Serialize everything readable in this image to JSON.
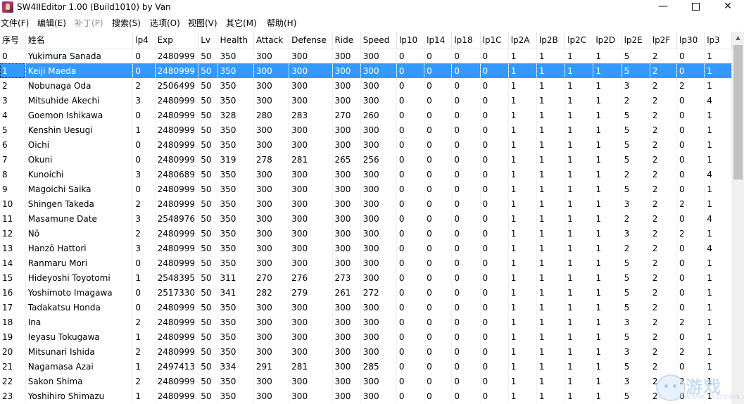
{
  "window": {
    "title": "SW4IIEditor 1.00 (Build1010) by Van",
    "minimize_glyph": "—",
    "close_glyph": "✕"
  },
  "menu": [
    {
      "label": "文件(F)",
      "enabled": true
    },
    {
      "label": "编辑(E)",
      "enabled": true
    },
    {
      "label": "补丁(P)",
      "enabled": false
    },
    {
      "label": "搜索(S)",
      "enabled": true
    },
    {
      "label": "选项(O)",
      "enabled": true
    },
    {
      "label": "视图(V)",
      "enabled": true
    },
    {
      "label": "其它(M)",
      "enabled": true
    },
    {
      "label": "帮助(H)",
      "enabled": true
    }
  ],
  "grid": {
    "columns": [
      "序号",
      "姓名",
      "lp4",
      "Exp",
      "Lv",
      "Health",
      "Attack",
      "Defense",
      "Ride",
      "Speed",
      "lp10",
      "lp14",
      "lp18",
      "lp1C",
      "lp2A",
      "lp2B",
      "lp2C",
      "lp2D",
      "lp2E",
      "lp2F",
      "lp30",
      "lp3"
    ],
    "selected_index": 1,
    "rows": [
      [
        "0",
        "Yukimura Sanada",
        "0",
        "2480999",
        "50",
        "350",
        "300",
        "300",
        "300",
        "300",
        "0",
        "0",
        "0",
        "0",
        "1",
        "1",
        "1",
        "1",
        "5",
        "2",
        "0",
        "1"
      ],
      [
        "1",
        "Keiji Maeda",
        "0",
        "2480999",
        "50",
        "350",
        "300",
        "300",
        "300",
        "300",
        "0",
        "0",
        "0",
        "0",
        "1",
        "1",
        "1",
        "1",
        "5",
        "2",
        "0",
        "1"
      ],
      [
        "2",
        "Nobunaga Oda",
        "2",
        "2506499",
        "50",
        "350",
        "300",
        "300",
        "300",
        "300",
        "0",
        "0",
        "0",
        "0",
        "1",
        "1",
        "1",
        "1",
        "3",
        "2",
        "2",
        "1"
      ],
      [
        "3",
        "Mitsuhide Akechi",
        "3",
        "2480999",
        "50",
        "350",
        "300",
        "300",
        "300",
        "300",
        "0",
        "0",
        "0",
        "0",
        "1",
        "1",
        "1",
        "1",
        "2",
        "2",
        "0",
        "4"
      ],
      [
        "4",
        "Goemon Ishikawa",
        "0",
        "2480999",
        "50",
        "328",
        "280",
        "283",
        "270",
        "260",
        "0",
        "0",
        "0",
        "0",
        "1",
        "1",
        "1",
        "1",
        "5",
        "2",
        "0",
        "1"
      ],
      [
        "5",
        "Kenshin Uesugi",
        "1",
        "2480999",
        "50",
        "350",
        "300",
        "300",
        "300",
        "300",
        "0",
        "0",
        "0",
        "0",
        "1",
        "1",
        "1",
        "1",
        "5",
        "2",
        "0",
        "1"
      ],
      [
        "6",
        "Oichi",
        "0",
        "2480999",
        "50",
        "350",
        "300",
        "300",
        "300",
        "300",
        "0",
        "0",
        "0",
        "0",
        "1",
        "1",
        "1",
        "1",
        "5",
        "2",
        "0",
        "1"
      ],
      [
        "7",
        "Okuni",
        "0",
        "2480999",
        "50",
        "319",
        "278",
        "281",
        "265",
        "256",
        "0",
        "0",
        "0",
        "0",
        "1",
        "1",
        "1",
        "1",
        "5",
        "2",
        "0",
        "1"
      ],
      [
        "8",
        "Kunoichi",
        "3",
        "2480689",
        "50",
        "350",
        "300",
        "300",
        "300",
        "300",
        "0",
        "0",
        "0",
        "0",
        "1",
        "1",
        "1",
        "1",
        "2",
        "2",
        "0",
        "4"
      ],
      [
        "9",
        "Magoichi Saika",
        "0",
        "2480999",
        "50",
        "350",
        "300",
        "300",
        "300",
        "300",
        "0",
        "0",
        "0",
        "0",
        "1",
        "1",
        "1",
        "1",
        "5",
        "2",
        "0",
        "1"
      ],
      [
        "10",
        "Shingen Takeda",
        "2",
        "2480999",
        "50",
        "350",
        "300",
        "300",
        "300",
        "300",
        "0",
        "0",
        "0",
        "0",
        "1",
        "1",
        "1",
        "1",
        "3",
        "2",
        "2",
        "1"
      ],
      [
        "11",
        "Masamune Date",
        "3",
        "2548976",
        "50",
        "350",
        "300",
        "300",
        "300",
        "300",
        "0",
        "0",
        "0",
        "0",
        "1",
        "1",
        "1",
        "1",
        "2",
        "2",
        "0",
        "4"
      ],
      [
        "12",
        "Nō",
        "2",
        "2480999",
        "50",
        "350",
        "300",
        "300",
        "300",
        "300",
        "0",
        "0",
        "0",
        "0",
        "1",
        "1",
        "1",
        "1",
        "3",
        "2",
        "2",
        "1"
      ],
      [
        "13",
        "Hanzō Hattori",
        "3",
        "2480999",
        "50",
        "350",
        "300",
        "300",
        "300",
        "300",
        "0",
        "0",
        "0",
        "0",
        "1",
        "1",
        "1",
        "1",
        "2",
        "2",
        "0",
        "4"
      ],
      [
        "14",
        "Ranmaru Mori",
        "0",
        "2480999",
        "50",
        "350",
        "300",
        "300",
        "300",
        "300",
        "0",
        "0",
        "0",
        "0",
        "1",
        "1",
        "1",
        "1",
        "5",
        "2",
        "0",
        "1"
      ],
      [
        "15",
        "Hideyoshi Toyotomi",
        "1",
        "2548395",
        "50",
        "311",
        "270",
        "276",
        "273",
        "300",
        "0",
        "0",
        "0",
        "0",
        "1",
        "1",
        "1",
        "1",
        "5",
        "2",
        "0",
        "1"
      ],
      [
        "16",
        "Yoshimoto Imagawa",
        "0",
        "2517330",
        "50",
        "341",
        "282",
        "279",
        "261",
        "272",
        "0",
        "0",
        "0",
        "0",
        "1",
        "1",
        "1",
        "1",
        "5",
        "2",
        "0",
        "1"
      ],
      [
        "17",
        "Tadakatsu Honda",
        "0",
        "2480999",
        "50",
        "350",
        "300",
        "300",
        "300",
        "300",
        "0",
        "0",
        "0",
        "0",
        "1",
        "1",
        "1",
        "1",
        "5",
        "2",
        "0",
        "1"
      ],
      [
        "18",
        "Ina",
        "2",
        "2480999",
        "50",
        "350",
        "300",
        "300",
        "300",
        "300",
        "0",
        "0",
        "0",
        "0",
        "1",
        "1",
        "1",
        "1",
        "3",
        "2",
        "2",
        "1"
      ],
      [
        "19",
        "Ieyasu Tokugawa",
        "1",
        "2480999",
        "50",
        "350",
        "300",
        "300",
        "300",
        "300",
        "0",
        "0",
        "0",
        "0",
        "1",
        "1",
        "1",
        "1",
        "5",
        "2",
        "0",
        "1"
      ],
      [
        "20",
        "Mitsunari Ishida",
        "2",
        "2480999",
        "50",
        "350",
        "300",
        "300",
        "300",
        "300",
        "0",
        "0",
        "0",
        "0",
        "1",
        "1",
        "1",
        "1",
        "3",
        "2",
        "2",
        "1"
      ],
      [
        "21",
        "Nagamasa Azai",
        "1",
        "2497413",
        "50",
        "334",
        "291",
        "281",
        "300",
        "285",
        "0",
        "0",
        "0",
        "0",
        "1",
        "1",
        "1",
        "1",
        "5",
        "2",
        "0",
        "1"
      ],
      [
        "22",
        "Sakon Shima",
        "2",
        "2480999",
        "50",
        "350",
        "300",
        "300",
        "300",
        "300",
        "0",
        "0",
        "0",
        "0",
        "1",
        "1",
        "1",
        "1",
        "3",
        "2",
        "2",
        "1"
      ],
      [
        "23",
        "Yoshihiro Shimazu",
        "1",
        "2480999",
        "50",
        "350",
        "300",
        "300",
        "300",
        "300",
        "0",
        "0",
        "0",
        "0",
        "1",
        "1",
        "1",
        "1",
        "5",
        "2",
        "0",
        "1"
      ]
    ]
  },
  "watermark": {
    "text": "游戏",
    "url": "WWW.YXDOWN.COM"
  },
  "colors": {
    "selection": "#3399ff",
    "disabled_text": "#8c8c8c"
  }
}
